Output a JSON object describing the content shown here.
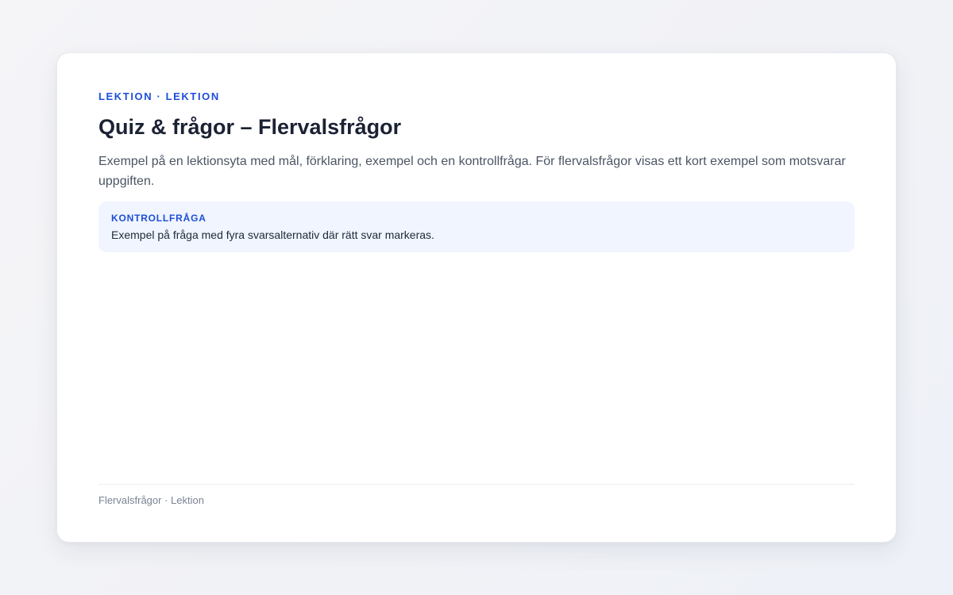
{
  "lesson": {
    "eyebrow": "LEKTION · LEKTION",
    "title": "Quiz & frågor – Flervalsfrågor",
    "lead": "Exempel på en lektionsyta med mål, förklaring, exempel och en kontrollfråga. För flervalsfrågor visas ett kort exempel som motsvarar uppgiften.",
    "callout": {
      "label": "KONTROLLFRÅGA",
      "text": "Exempel på fråga med fyra svarsalternativ där rätt svar markeras."
    },
    "footer": "Flervalsfrågor · Lektion"
  },
  "colors": {
    "accent": "#1d4ed8",
    "callout_bg": "#f0f5ff",
    "title": "#1b2233",
    "muted": "#7b8494"
  }
}
